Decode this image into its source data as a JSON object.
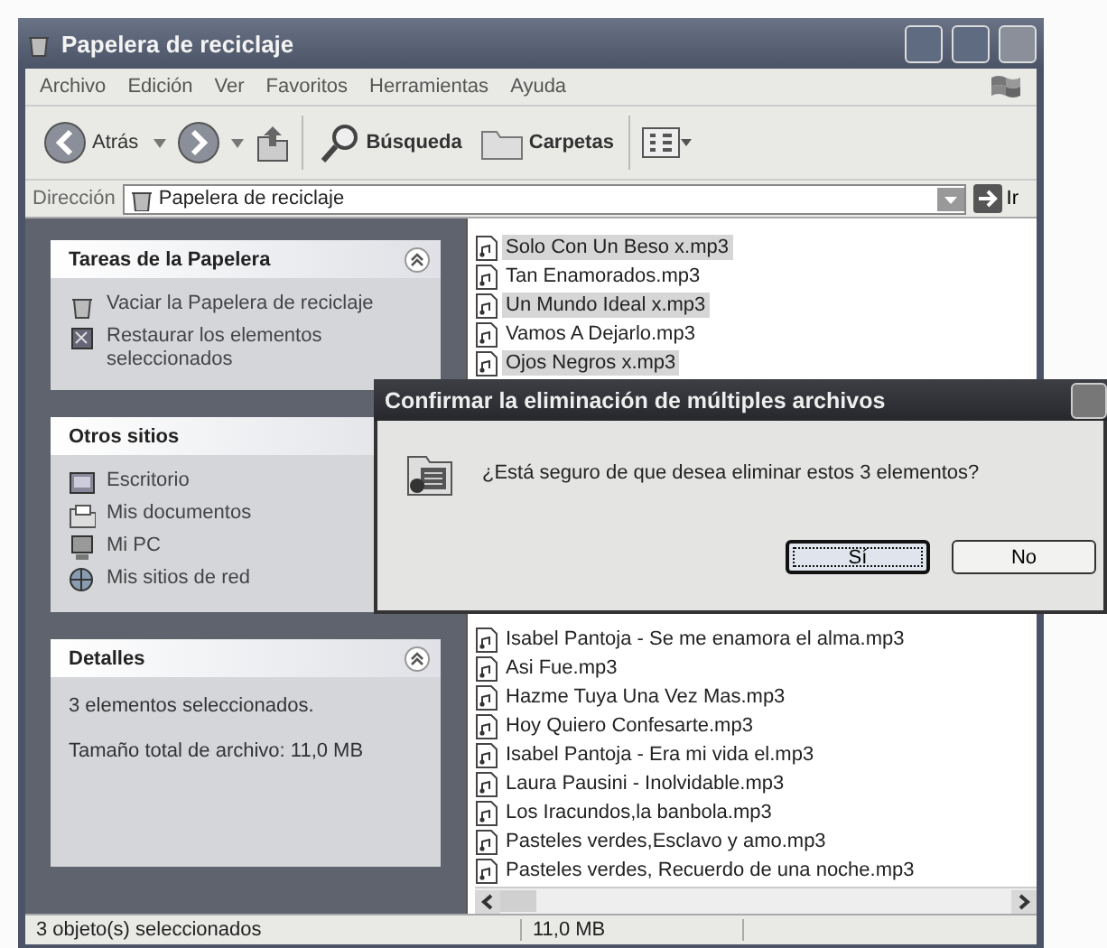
{
  "window": {
    "title": "Papelera de reciclaje"
  },
  "menu": [
    "Archivo",
    "Edición",
    "Ver",
    "Favoritos",
    "Herramientas",
    "Ayuda"
  ],
  "toolbar": {
    "back": "Atrás",
    "search": "Búsqueda",
    "folders": "Carpetas"
  },
  "address": {
    "label": "Dirección",
    "value": "Papelera de reciclaje",
    "go": "Ir"
  },
  "sidebar": [
    {
      "kind": "links",
      "title": "Tareas de la Papelera",
      "items": [
        "Vaciar la Papelera de reciclaje",
        "Restaurar los elementos seleccionados"
      ]
    },
    {
      "kind": "links",
      "title": "Otros sitios",
      "items": [
        "Escritorio",
        "Mis documentos",
        "Mi PC",
        "Mis sitios de red"
      ]
    },
    {
      "kind": "details",
      "title": "Detalles",
      "items": [
        "3 elementos seleccionados.",
        "Tamaño total de archivo: 11,0 MB"
      ]
    }
  ],
  "files_above_dialog": [
    {
      "name": "Solo Con Un Beso x.mp3",
      "selected": true
    },
    {
      "name": "Tan Enamorados.mp3",
      "selected": false
    },
    {
      "name": "Un Mundo Ideal x.mp3",
      "selected": true
    },
    {
      "name": "Vamos A Dejarlo.mp3",
      "selected": false
    },
    {
      "name": "Ojos Negros x.mp3",
      "selected": true
    }
  ],
  "files_below_dialog": [
    {
      "name": "Isabel Pantoja - Se me enamora el alma.mp3",
      "selected": false
    },
    {
      "name": "Asi Fue.mp3",
      "selected": false
    },
    {
      "name": "Hazme Tuya Una Vez Mas.mp3",
      "selected": false
    },
    {
      "name": "Hoy Quiero Confesarte.mp3",
      "selected": false
    },
    {
      "name": "Isabel Pantoja - Era mi vida el.mp3",
      "selected": false
    },
    {
      "name": "Laura Pausini - Inolvidable.mp3",
      "selected": false
    },
    {
      "name": "Los Iracundos,la banbola.mp3",
      "selected": false
    },
    {
      "name": "Pasteles verdes,Esclavo y amo.mp3",
      "selected": false
    },
    {
      "name": "Pasteles verdes, Recuerdo de una noche.mp3",
      "selected": false
    }
  ],
  "dialog": {
    "title": "Confirmar la eliminación de múltiples archivos",
    "message": "¿Está seguro de que desea eliminar estos 3 elementos?",
    "buttons": [
      {
        "label": "Sí",
        "focused": true
      },
      {
        "label": "No",
        "focused": false
      }
    ]
  },
  "status_bar": [
    "3 objeto(s) seleccionados",
    "11,0 MB"
  ]
}
